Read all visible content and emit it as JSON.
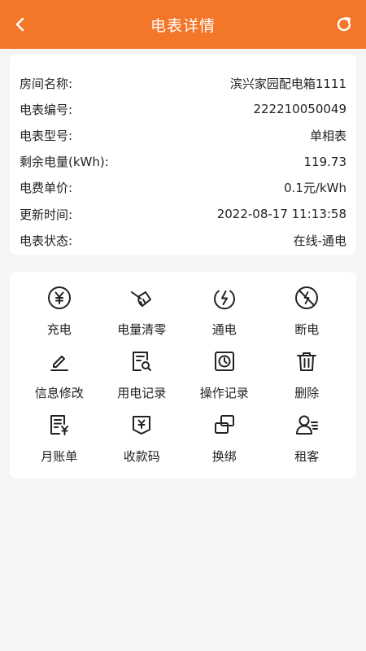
{
  "header": {
    "title": "电表详情",
    "back_icon": "chevron-left-icon",
    "refresh_icon": "refresh-icon",
    "color": "#f47629"
  },
  "info": {
    "room_name": {
      "label": "房间名称:",
      "value": "滨兴家园配电箱1111"
    },
    "meter_no": {
      "label": "电表编号:",
      "value": "222210050049"
    },
    "meter_model": {
      "label": "电表型号:",
      "value": "单相表"
    },
    "remaining": {
      "label": "剩余电量(kWh):",
      "value": "119.73"
    },
    "price": {
      "label": "电费单价:",
      "value": "0.1元/kWh"
    },
    "update_time": {
      "label": "更新时间:",
      "value": "2022-08-17 11:13:58"
    },
    "status": {
      "label": "电表状态:",
      "value": "在线-通电"
    }
  },
  "actions": [
    {
      "label": "充电",
      "icon": "yuan-circle-icon"
    },
    {
      "label": "电量清零",
      "icon": "broom-icon"
    },
    {
      "label": "通电",
      "icon": "power-on-icon"
    },
    {
      "label": "断电",
      "icon": "power-off-icon"
    },
    {
      "label": "信息修改",
      "icon": "edit-icon"
    },
    {
      "label": "用电记录",
      "icon": "usage-record-icon"
    },
    {
      "label": "操作记录",
      "icon": "operation-record-icon"
    },
    {
      "label": "删除",
      "icon": "trash-icon"
    },
    {
      "label": "月账单",
      "icon": "monthly-bill-icon"
    },
    {
      "label": "收款码",
      "icon": "payment-code-icon"
    },
    {
      "label": "换绑",
      "icon": "rebind-icon"
    },
    {
      "label": "租客",
      "icon": "tenant-icon"
    }
  ]
}
